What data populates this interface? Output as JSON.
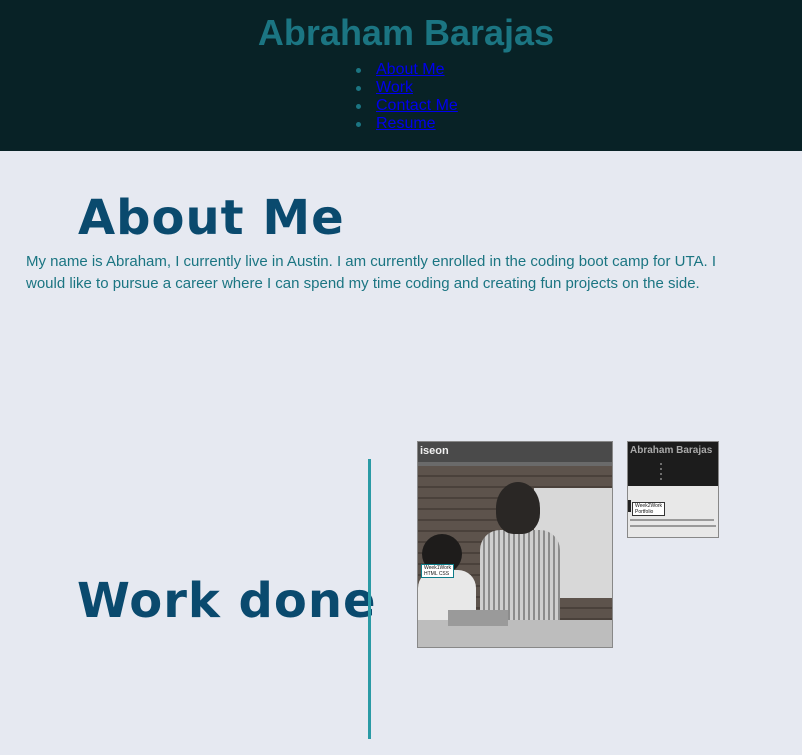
{
  "header": {
    "title": "Abraham Barajas",
    "nav": [
      {
        "label": "About Me"
      },
      {
        "label": "Work"
      },
      {
        "label": "Contact Me"
      },
      {
        "label": "Resume"
      }
    ]
  },
  "about": {
    "heading": "About Me",
    "text": "My name is Abraham, I currently live in Austin. I am currently enrolled in the coding boot camp for UTA. I would like to pursue a career where I can spend my time coding and creating fun projects on the side."
  },
  "work": {
    "heading": "Work done",
    "projects": [
      {
        "brand": "iseon",
        "label_line1": "Week1Work",
        "label_line2": "HTML CSS"
      },
      {
        "brand": "Abraham Barajas",
        "label_line1": "Week2Work",
        "label_line2": "Portfolio"
      }
    ]
  },
  "colors": {
    "header_bg": "#082226",
    "page_bg": "#e6e9f1",
    "accent": "#1b7582",
    "heading": "#0a4a6e",
    "divider": "#2a9aa5"
  }
}
